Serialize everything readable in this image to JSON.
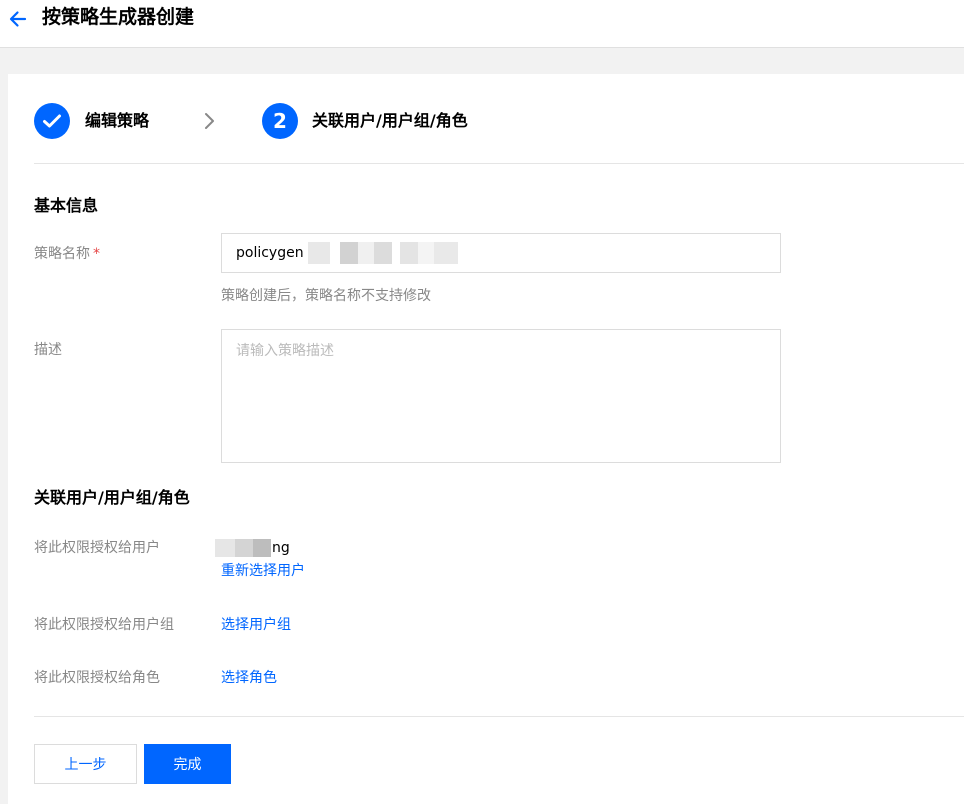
{
  "header": {
    "title": "按策略生成器创建"
  },
  "steps": [
    {
      "number": "1",
      "label": "编辑策略",
      "status": "completed"
    },
    {
      "number": "2",
      "label": "关联用户/用户组/角色",
      "status": "active"
    }
  ],
  "basic_info": {
    "section_title": "基本信息",
    "name_label": "策略名称",
    "required_mark": "*",
    "name_value": "policygen",
    "name_hint": "策略创建后，策略名称不支持修改",
    "desc_label": "描述",
    "desc_placeholder": "请输入策略描述"
  },
  "association": {
    "section_title": "关联用户/用户组/角色",
    "user_label": "将此权限授权给用户",
    "user_value": "ng",
    "reselect_user_link": "重新选择用户",
    "group_label": "将此权限授权给用户组",
    "select_group_link": "选择用户组",
    "role_label": "将此权限授权给角色",
    "select_role_link": "选择角色"
  },
  "footer": {
    "prev_label": "上一步",
    "done_label": "完成"
  },
  "colors": {
    "primary": "#0066ff",
    "required": "#e54545",
    "muted_text": "#888888"
  }
}
